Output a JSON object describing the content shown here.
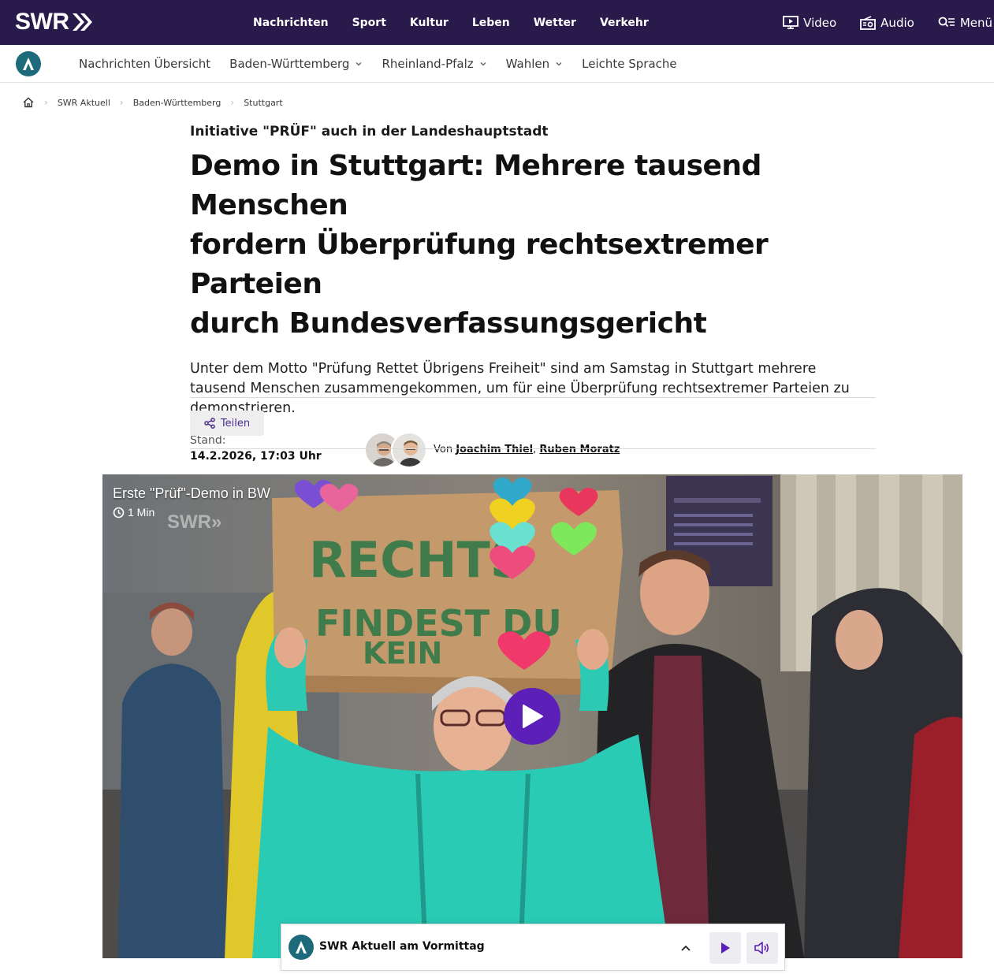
{
  "header": {
    "logo": "SWR",
    "nav": [
      "Nachrichten",
      "Sport",
      "Kultur",
      "Leben",
      "Wetter",
      "Verkehr"
    ],
    "video_label": "Video",
    "audio_label": "Audio",
    "menu_label": "Menü"
  },
  "subnav": {
    "items": [
      {
        "label": "Nachrichten Übersicht",
        "dropdown": false
      },
      {
        "label": "Baden-Württemberg",
        "dropdown": true
      },
      {
        "label": "Rheinland-Pfalz",
        "dropdown": true
      },
      {
        "label": "Wahlen",
        "dropdown": true
      },
      {
        "label": "Leichte Sprache",
        "dropdown": false
      }
    ]
  },
  "breadcrumb": [
    "SWR Aktuell",
    "Baden-Württemberg",
    "Stuttgart"
  ],
  "article": {
    "kicker": "Initiative \"PRÜF\" auch in der Landeshauptstadt",
    "headline_lines": [
      "Demo in Stuttgart: Mehrere tausend Menschen",
      "fordern Überprüfung rechtsextremer Parteien",
      "durch Bundesverfassungsgericht"
    ],
    "lead": "Unter dem Motto \"Prüfung Rettet Übrigens Freiheit\" sind am Samstag in Stuttgart mehrere tausend Menschen zusammengekommen, um für eine Überprüfung rechtsextremer Parteien zu demonstrieren.",
    "stand_label": "Stand:",
    "stand_value": "14.2.2026, 17:03 Uhr",
    "by_prefix": "Von",
    "author1": "Joachim Thiel",
    "author_sep": ",",
    "author2": "Ruben Moratz",
    "share_label": "Teilen"
  },
  "video": {
    "title": "Erste \"Prüf\"-Demo in BW",
    "duration": "1 Min",
    "sign_line1": "RECHTS",
    "sign_line2": "FINDEST DU",
    "sign_line3": "KEIN"
  },
  "player": {
    "title": "SWR Aktuell am Vormittag"
  },
  "colors": {
    "topbar": "#281a4b",
    "brand_teal": "#1d6a7a",
    "accent_purple": "#5c1fb8"
  }
}
